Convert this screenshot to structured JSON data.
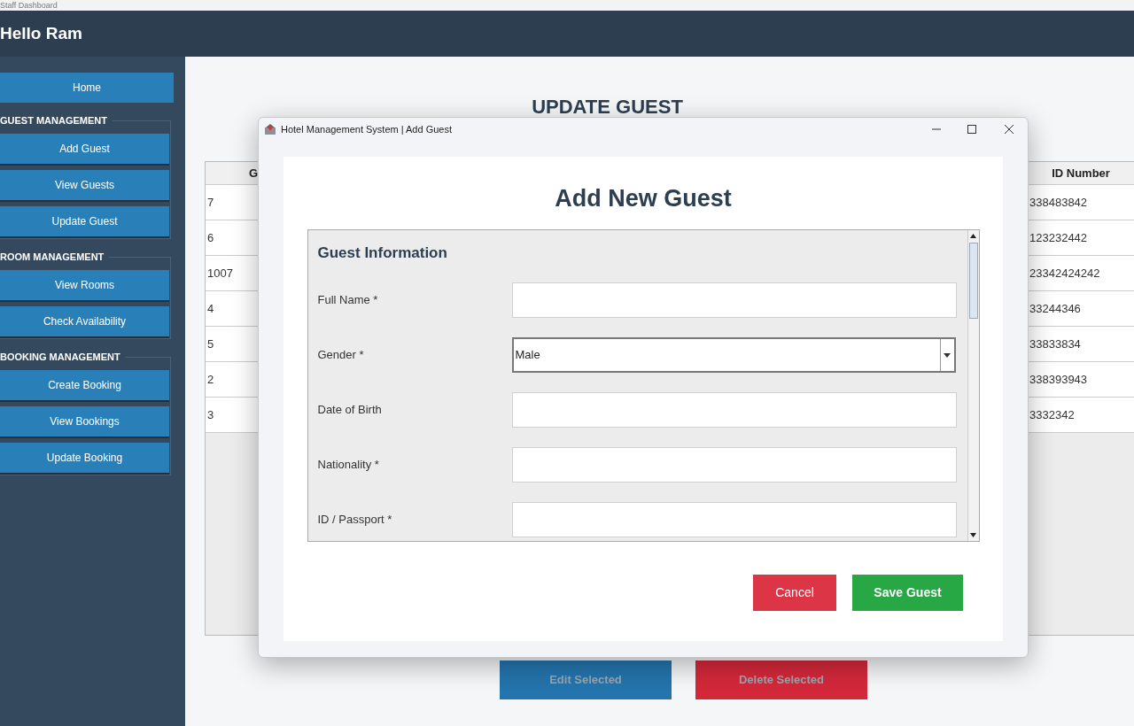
{
  "window": {
    "title": "Staff Dashboard"
  },
  "header": {
    "greeting": "Hello Ram"
  },
  "sidebar": {
    "home": {
      "label": "Home"
    },
    "groups": [
      {
        "title": "GUEST MANAGEMENT",
        "items": [
          {
            "label": "Add Guest"
          },
          {
            "label": "View Guests"
          },
          {
            "label": "Update Guest"
          }
        ]
      },
      {
        "title": "ROOM MANAGEMENT",
        "items": [
          {
            "label": "View Rooms"
          },
          {
            "label": "Check Availability"
          }
        ]
      },
      {
        "title": "BOOKING MANAGEMENT",
        "items": [
          {
            "label": "Create Booking"
          },
          {
            "label": "View Bookings"
          },
          {
            "label": "Update Booking"
          }
        ]
      }
    ]
  },
  "main": {
    "heading": "UPDATE GUEST",
    "table": {
      "columns": [
        "G",
        "ID Number"
      ],
      "rows": [
        [
          "7",
          "338483842"
        ],
        [
          "6",
          "123232442"
        ],
        [
          "1007",
          "23342424242"
        ],
        [
          "4",
          "33244346"
        ],
        [
          "5",
          "33833834"
        ],
        [
          "2",
          "338393943"
        ],
        [
          "3",
          "3332342"
        ]
      ]
    },
    "buttons": [
      {
        "label": "Edit Selected",
        "kind": "edit"
      },
      {
        "label": "Delete Selected",
        "kind": "delete"
      }
    ]
  },
  "dialog": {
    "title": "Hotel Management System | Add Guest",
    "heading": "Add New Guest",
    "section": "Guest Information",
    "fields": [
      {
        "label": "Full Name *",
        "kind": "text"
      },
      {
        "label": "Gender *",
        "kind": "select",
        "value": "Male"
      },
      {
        "label": "Date of Birth",
        "kind": "text"
      },
      {
        "label": "Nationality *",
        "kind": "text"
      },
      {
        "label": "ID / Passport *",
        "kind": "text"
      }
    ],
    "buttons": [
      {
        "label": "Cancel",
        "kind": "cancel"
      },
      {
        "label": "Save Guest",
        "kind": "save"
      }
    ]
  }
}
